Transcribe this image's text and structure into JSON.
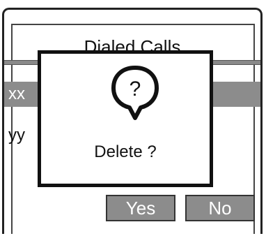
{
  "screen": {
    "title": "Dialed Calls"
  },
  "list": {
    "items": [
      {
        "label": "xx"
      },
      {
        "label": "yy"
      }
    ]
  },
  "dialog": {
    "icon": "question-bubble-icon",
    "icon_glyph": "?",
    "message": "Delete ?"
  },
  "buttons": {
    "yes_label": "Yes",
    "no_label": "No"
  },
  "colors": {
    "highlight": "#8c8c8c",
    "border": "#111111"
  }
}
